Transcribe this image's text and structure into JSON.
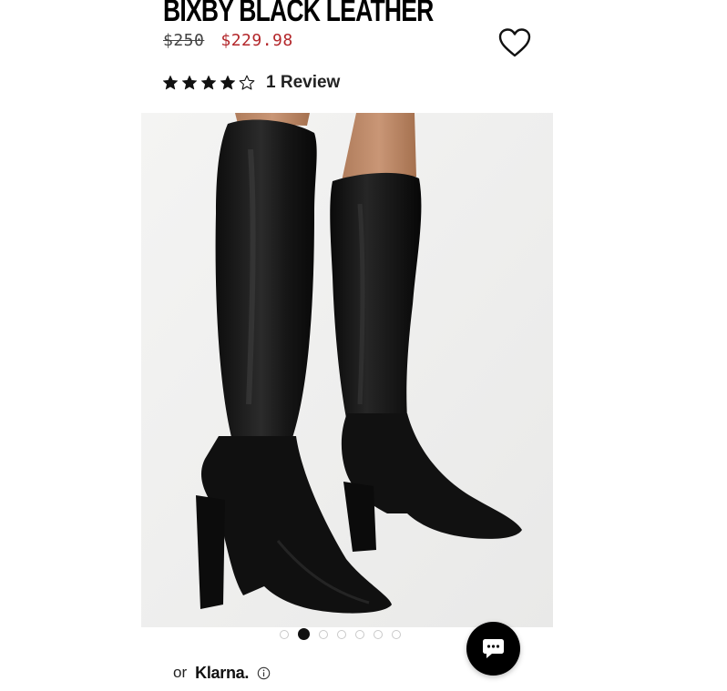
{
  "product": {
    "title": "BIXBY BLACK LEATHER",
    "original_price": "$250",
    "sale_price": "$229.98",
    "rating": 4,
    "rating_max": 5,
    "review_label": "1 Review"
  },
  "gallery": {
    "image_count": 7,
    "active_index": 1
  },
  "payment": {
    "or_label": "or",
    "provider_label": "Klarna."
  },
  "colors": {
    "sale_price": "#b3262a",
    "chat_button": "#000000"
  },
  "icons": {
    "wishlist": "heart-outline-icon",
    "star_full": "star-filled-icon",
    "star_empty": "star-outline-icon",
    "info": "info-circle-icon",
    "chat": "chat-bubble-icon"
  }
}
